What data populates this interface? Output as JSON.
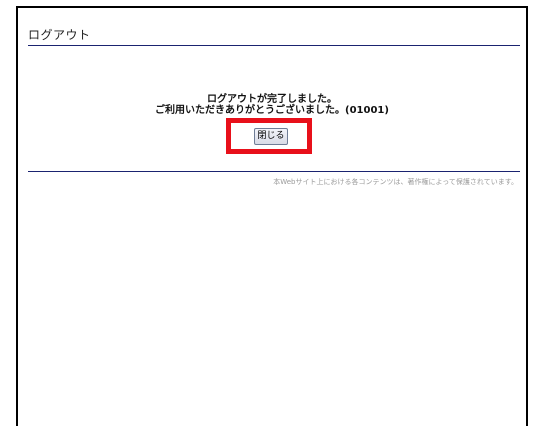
{
  "page": {
    "title": "ログアウト"
  },
  "message": {
    "line1": "ログアウトが完了しました。",
    "line2": "ご利用いただきありがとうございました。(01001)"
  },
  "buttons": {
    "close_label": "閉じる"
  },
  "footer": {
    "copyright": "本Webサイト上における各コンテンツは、著作権によって保護されています。"
  },
  "colors": {
    "rule": "#1a2370",
    "highlight": "#e8101a"
  }
}
